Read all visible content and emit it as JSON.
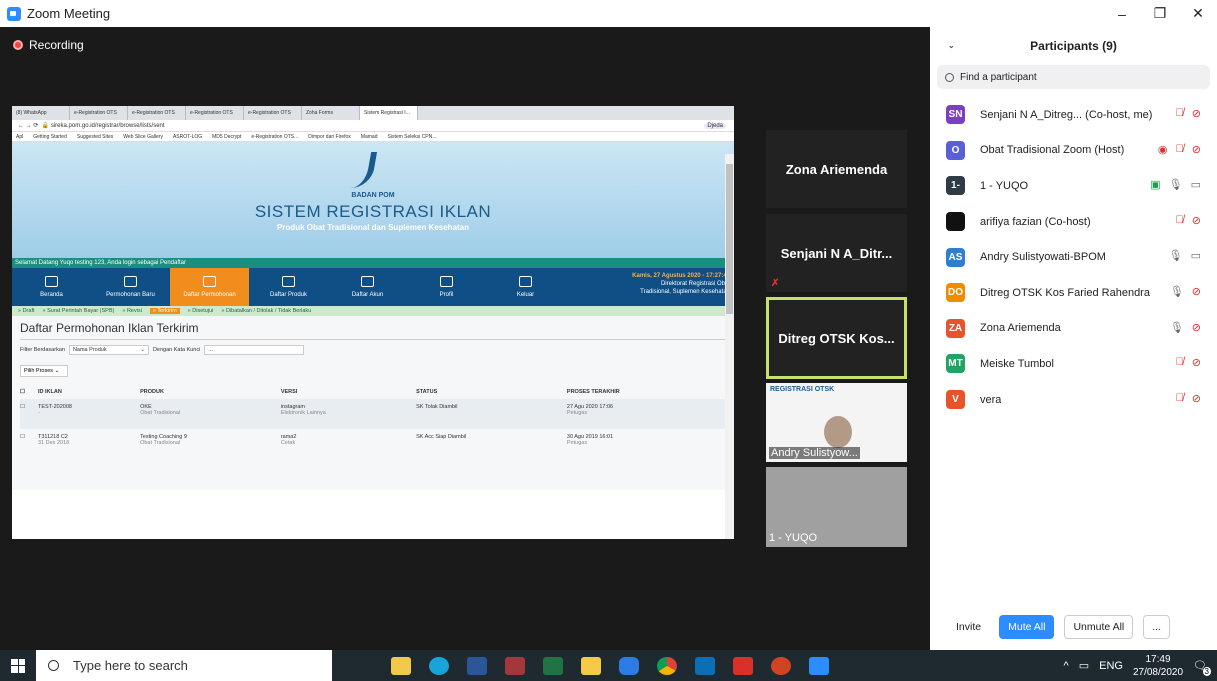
{
  "window": {
    "title": "Zoom Meeting",
    "controls": [
      "–",
      "❐",
      "✕"
    ]
  },
  "recording": {
    "label": "Recording"
  },
  "browser": {
    "tabs": [
      "(8) WhatsApp",
      "e-Registration OTS",
      "e-Registration OTS",
      "e-Registration OTS",
      "e-Registration OTS",
      "Zoha Forms",
      "Sistem Registrasi I..."
    ],
    "url": "sireka.pom.go.id/registrar/browse/lists/sent",
    "profile": "Djeda",
    "bookmarks": [
      "Apl",
      "Getting Started",
      "Suggested Sites",
      "Web Slice Gallery",
      "ASROT-LOG",
      "MD5 Decrypt",
      "e-Registration OTS...",
      "Dimpor dari Firefox",
      "Mamad",
      "Sistem Seleksi CPN..."
    ]
  },
  "site": {
    "org": "BADAN POM",
    "title": "SISTEM REGISTRASI IKLAN",
    "subtitle": "Produk Obat Tradisional dan Suplemen Kesehatan",
    "welcome": "Selamat Datang Yuqo testing 123, Anda login sebagai Pendaftar",
    "nav": [
      "Beranda",
      "Permohonan Baru",
      "Daftar Permohonan",
      "Daftar Produk",
      "Daftar Akun",
      "Profil",
      "Keluar"
    ],
    "date": "Kamis, 27 Agustus 2020 - 17:27:42",
    "dept_line1": "Direktorat Registrasi Obat",
    "dept_line2": "Tradisional, Suplemen Kesehatan",
    "subnav": [
      "» Draft",
      "» Surat Perintah Bayar (SPB)",
      "» Revisi",
      "» Terkirim",
      "» Disetujui",
      "» Dibatalkan / Ditolak / Tidak Berlaku"
    ],
    "page_title": "Daftar Permohonan Iklan Terkirim",
    "filter_label": "Filter Berdasarkan",
    "filter_value": "Nama Produk",
    "keyword_label": "Dengan Kata Kunci",
    "keyword_placeholder": "...",
    "proses": "Pilih Proses",
    "columns": [
      "ID IKLAN",
      "PRODUK",
      "VERSI",
      "STATUS",
      "PROSES TERAKHIR"
    ],
    "rows": [
      {
        "id": "TEST-202008",
        "id_sub": "-",
        "produk": "OKE",
        "produk_sub": "Obat Tradisional",
        "versi": "instagram",
        "versi_sub": "Elektronik Lainnya",
        "status": "SK Tolak Diambil",
        "proses": "27 Agu 2020 17:06",
        "proses_sub": "Petugas"
      },
      {
        "id": "T311218 C2",
        "id_sub": "31 Des 2018",
        "produk": "Testing Coaching 9",
        "produk_sub": "Obat Tradisional",
        "versi": "rama2",
        "versi_sub": "Cetak",
        "status": "SK Acc Siap Diambil",
        "proses": "30 Agu 2019 16:01",
        "proses_sub": "Petugas"
      }
    ]
  },
  "tiles": [
    {
      "name": "Zona Ariemenda"
    },
    {
      "name": "Senjani N A_Ditr..."
    },
    {
      "name": "Ditreg OTSK Kos..."
    },
    {
      "name": "Andry Sulistyow...",
      "banner": "REGISTRASI OTSK"
    },
    {
      "name": "1 - YUQO"
    }
  ],
  "participants_panel": {
    "title": "Participants (9)",
    "search_placeholder": "Find a participant",
    "participants": [
      {
        "initials": "SN",
        "color": "#7b3fc4",
        "name": "Senjani N A_Ditreg... (Co-host, me)",
        "mic": "muted",
        "video": "off"
      },
      {
        "initials": "O",
        "color": "#5a5fd6",
        "name": "Obat Tradisional Zoom (Host)",
        "mic": "muted",
        "video": "off",
        "recording": true
      },
      {
        "initials": "1-",
        "color": "#2f3b45",
        "name": "1 - YUQO",
        "mic": "on",
        "video": "on",
        "sharing": true
      },
      {
        "initials": "",
        "color": "#111111",
        "name": "arifiya fazian (Co-host)",
        "mic": "muted",
        "video": "off"
      },
      {
        "initials": "AS",
        "color": "#2e7fd0",
        "name": "Andry Sulistyowati-BPOM",
        "mic": "on",
        "video": "on"
      },
      {
        "initials": "DO",
        "color": "#f08c00",
        "name": "Ditreg OTSK Kos Faried Rahendra",
        "mic": "on",
        "video": "off"
      },
      {
        "initials": "ZA",
        "color": "#e8532a",
        "name": "Zona Ariemenda",
        "mic": "on",
        "video": "off"
      },
      {
        "initials": "MT",
        "color": "#21a366",
        "name": "Meiske Tumbol",
        "mic": "muted",
        "video": "off"
      },
      {
        "initials": "V",
        "color": "#e8532a",
        "name": "vera",
        "mic": "muted",
        "video": "off"
      }
    ],
    "buttons": {
      "invite": "Invite",
      "mute_all": "Mute All",
      "unmute_all": "Unmute All",
      "more": "..."
    }
  },
  "taskbar": {
    "search_placeholder": "Type here to search",
    "lang": "ENG",
    "time": "17:49",
    "date": "27/08/2020",
    "notifications": "3"
  }
}
